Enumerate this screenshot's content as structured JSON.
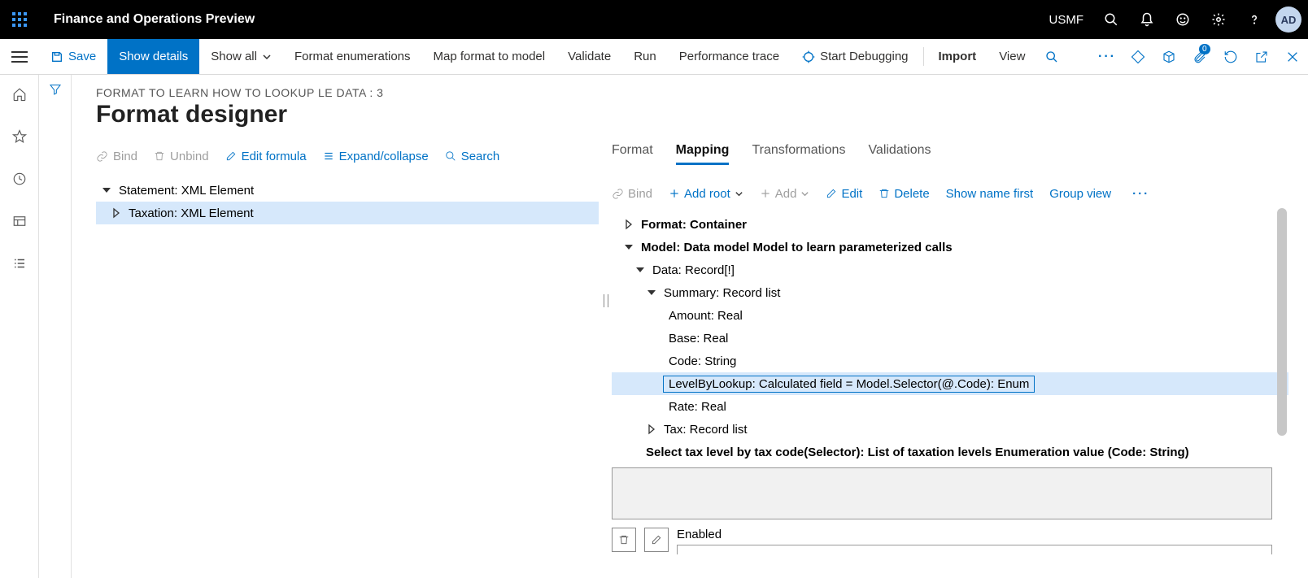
{
  "header": {
    "app_title": "Finance and Operations Preview",
    "company": "USMF",
    "avatar": "AD"
  },
  "cmdbar": {
    "save": "Save",
    "show_details": "Show details",
    "show_all": "Show all",
    "format_enum": "Format enumerations",
    "map_format": "Map format to model",
    "validate": "Validate",
    "run": "Run",
    "perf_trace": "Performance trace",
    "start_debug": "Start Debugging",
    "import": "Import",
    "view": "View",
    "badge_count": "0"
  },
  "breadcrumb": "FORMAT TO LEARN HOW TO LOOKUP LE DATA : 3",
  "page_title": "Format designer",
  "left": {
    "toolbar": {
      "bind": "Bind",
      "unbind": "Unbind",
      "edit_formula": "Edit formula",
      "expand": "Expand/collapse",
      "search": "Search"
    },
    "tree": {
      "n1": "Statement: XML Element",
      "n2": "Taxation: XML Element"
    }
  },
  "tabs": {
    "format": "Format",
    "mapping": "Mapping",
    "transformations": "Transformations",
    "validations": "Validations"
  },
  "right": {
    "toolbar": {
      "bind": "Bind",
      "add_root": "Add root",
      "add": "Add",
      "edit": "Edit",
      "delete": "Delete",
      "show_name": "Show name first",
      "group_view": "Group view"
    },
    "tree": {
      "n1": "Format: Container",
      "n2": "Model: Data model Model to learn parameterized calls",
      "n3": "Data: Record[!]",
      "n4": "Summary: Record list",
      "n5": "Amount: Real",
      "n6": "Base: Real",
      "n7": "Code: String",
      "n8": "LevelByLookup: Calculated field = Model.Selector(@.Code): Enum",
      "n9": "Rate: Real",
      "n10": "Tax: Record list",
      "desc": "Select tax level by tax code(Selector): List of taxation levels Enumeration value (Code: String)"
    },
    "enabled": "Enabled"
  }
}
